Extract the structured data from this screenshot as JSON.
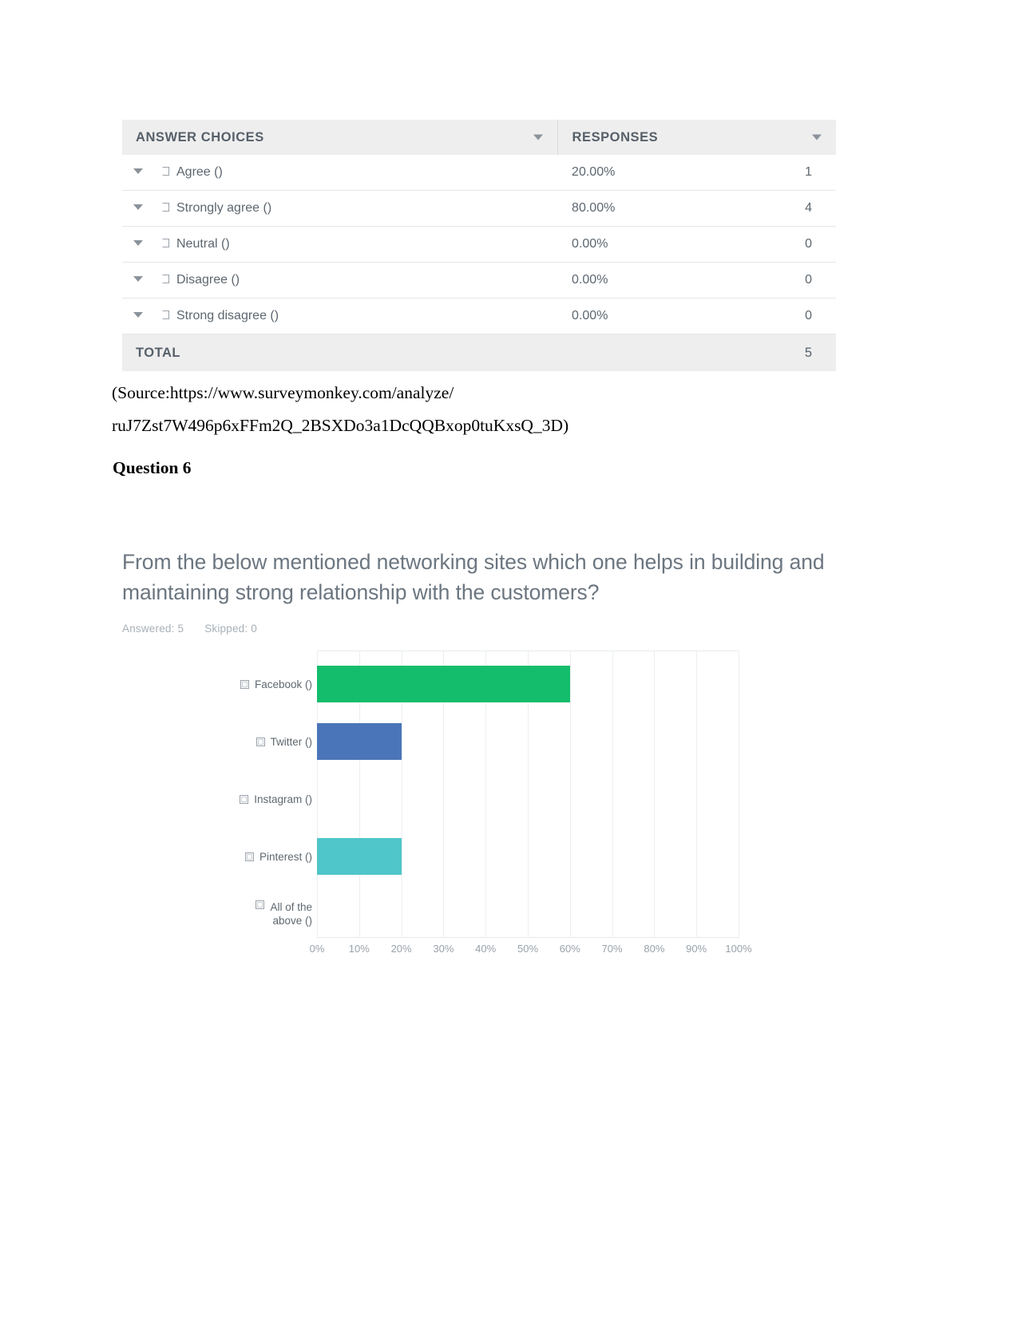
{
  "table": {
    "headers": {
      "choices": "ANSWER CHOICES",
      "responses": "RESPONSES"
    },
    "rows": [
      {
        "label": "Agree ()",
        "percent": "20.00%",
        "count": "1"
      },
      {
        "label": "Strongly agree ()",
        "percent": "80.00%",
        "count": "4"
      },
      {
        "label": "Neutral ()",
        "percent": "0.00%",
        "count": "0"
      },
      {
        "label": "Disagree ()",
        "percent": "0.00%",
        "count": "0"
      },
      {
        "label": "Strong disagree ()",
        "percent": "0.00%",
        "count": "0"
      }
    ],
    "total": {
      "label": "TOTAL",
      "count": "5"
    }
  },
  "source": {
    "line1": "(Source:https://www.surveymonkey.com/analyze/",
    "line2": "ruJ7Zst7W496p6xFFm2Q_2BSXDo3a1DcQQBxop0tuKxsQ_3D)"
  },
  "question_heading": "Question 6",
  "chart_data": {
    "type": "bar",
    "orientation": "horizontal",
    "title_line1": "From the below mentioned networking sites which one helps in building and",
    "title_line2": "maintaining strong relationship with the customers?",
    "answered_label": "Answered: 5",
    "skipped_label": "Skipped: 0",
    "categories": [
      "Facebook ()",
      "Twitter ()",
      "Instagram ()",
      "Pinterest ()",
      "All of the\nabove ()"
    ],
    "category_lines": [
      [
        "Facebook ()"
      ],
      [
        "Twitter ()"
      ],
      [
        "Instagram ()"
      ],
      [
        "Pinterest ()"
      ],
      [
        "All of the",
        "above ()"
      ]
    ],
    "values": [
      60,
      20,
      0,
      20,
      0
    ],
    "colors": [
      "#13bd6c",
      "#4a75b9",
      "#ffffff",
      "#4fc6c9",
      "#ffffff"
    ],
    "xlabel": "",
    "ylabel": "",
    "xlim": [
      0,
      100
    ],
    "tick_labels": [
      "0%",
      "10%",
      "20%",
      "30%",
      "40%",
      "50%",
      "60%",
      "70%",
      "80%",
      "90%",
      "100%"
    ],
    "tick_values": [
      0,
      10,
      20,
      30,
      40,
      50,
      60,
      70,
      80,
      90,
      100
    ],
    "grid": true,
    "legend": "none"
  }
}
